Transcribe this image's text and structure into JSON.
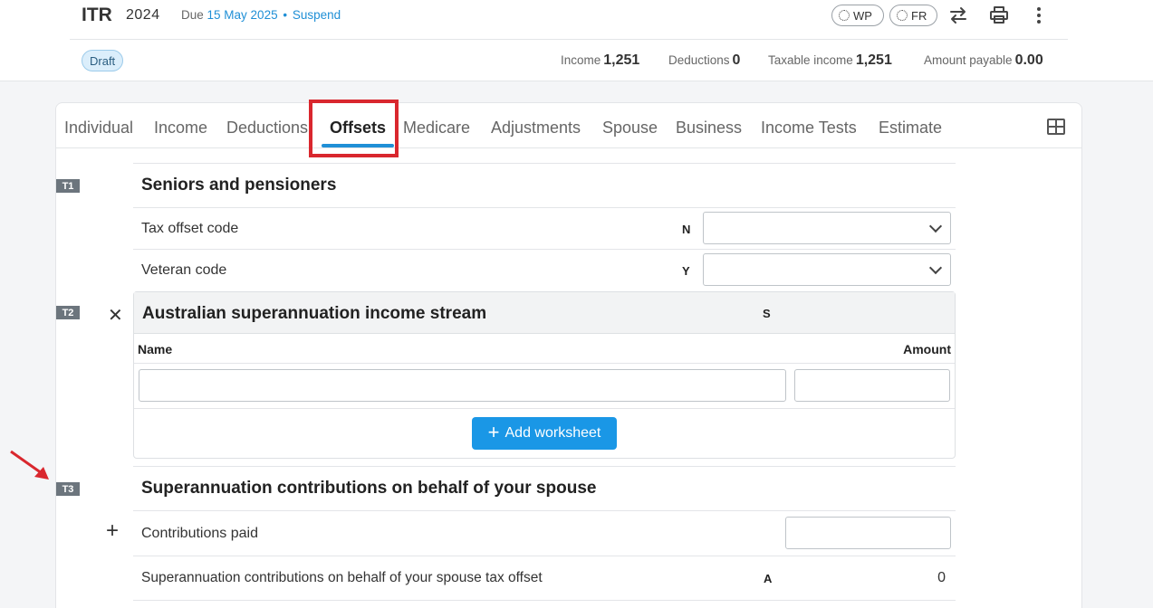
{
  "header": {
    "title": "ITR",
    "year": "2024",
    "due_prefix": "Due",
    "due_date": "15 May 2025",
    "bullet": "•",
    "suspend": "Suspend",
    "pill_wp": "WP",
    "pill_fr": "FR",
    "status": "Draft",
    "stats": {
      "income_label": "Income",
      "income_value": "1,251",
      "deductions_label": "Deductions",
      "deductions_value": "0",
      "taxable_label": "Taxable income",
      "taxable_value": "1,251",
      "payable_label": "Amount payable",
      "payable_value": "0.00"
    }
  },
  "tabs": [
    "Individual",
    "Income",
    "Deductions",
    "Offsets",
    "Medicare",
    "Adjustments",
    "Spouse",
    "Business",
    "Income Tests",
    "Estimate"
  ],
  "active_tab": "Offsets",
  "sections": {
    "t1": {
      "tag": "T1",
      "title": "Seniors and pensioners",
      "row1_label": "Tax offset code",
      "row1_code": "N",
      "row2_label": "Veteran code",
      "row2_code": "Y"
    },
    "t2": {
      "tag": "T2",
      "title": "Australian superannuation income stream",
      "code": "S",
      "col_name": "Name",
      "col_amount": "Amount",
      "add_button": "Add worksheet"
    },
    "t3": {
      "tag": "T3",
      "title": "Superannuation contributions on behalf of your spouse",
      "row1_label": "Contributions paid",
      "row2_label": "Superannuation contributions on behalf of your spouse tax offset",
      "row2_code": "A",
      "row2_value": "0"
    }
  },
  "colors": {
    "accent": "#1f8fd6",
    "highlight_box": "#d9272e",
    "tag_bg": "#6c757d"
  }
}
